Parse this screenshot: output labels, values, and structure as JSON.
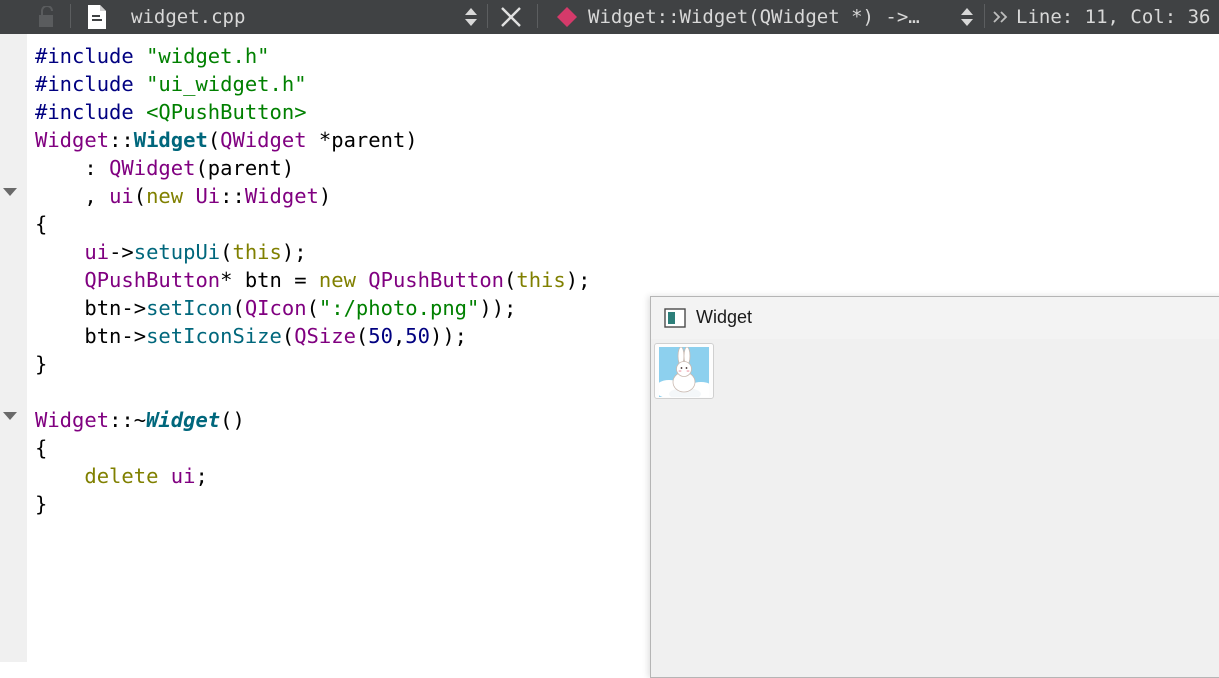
{
  "toolbar": {
    "file_name": "widget.cpp",
    "symbol": "Widget::Widget(QWidget *) ->…",
    "position": "Line: 11, Col: 36"
  },
  "code": {
    "lines": [
      [
        [
          "d",
          "#include "
        ],
        [
          "s",
          "\"widget.h\""
        ]
      ],
      [
        [
          "d",
          "#include "
        ],
        [
          "s",
          "\"ui_widget.h\""
        ]
      ],
      [
        [
          "d",
          "#include "
        ],
        [
          "s",
          "<QPushButton>"
        ]
      ],
      [
        [
          "t",
          "Widget"
        ],
        [
          "",
          "::"
        ],
        [
          "b",
          "Widget"
        ],
        [
          "",
          "("
        ],
        [
          "t",
          "QWidget"
        ],
        [
          "",
          " *parent)"
        ]
      ],
      [
        [
          "",
          "    : "
        ],
        [
          "t",
          "QWidget"
        ],
        [
          "",
          "(parent)"
        ]
      ],
      [
        [
          "",
          "    , "
        ],
        [
          "t",
          "ui"
        ],
        [
          "",
          "("
        ],
        [
          "k",
          "new"
        ],
        [
          "",
          " "
        ],
        [
          "t",
          "Ui"
        ],
        [
          "",
          "::"
        ],
        [
          "t",
          "Widget"
        ],
        [
          "",
          ")"
        ]
      ],
      [
        [
          "",
          "{"
        ]
      ],
      [
        [
          "",
          "    "
        ],
        [
          "t",
          "ui"
        ],
        [
          "",
          "->"
        ],
        [
          "f",
          "setupUi"
        ],
        [
          "",
          "("
        ],
        [
          "k",
          "this"
        ],
        [
          "",
          ");"
        ]
      ],
      [
        [
          "",
          "    "
        ],
        [
          "t",
          "QPushButton"
        ],
        [
          "",
          "* btn = "
        ],
        [
          "k",
          "new"
        ],
        [
          "",
          " "
        ],
        [
          "t",
          "QPushButton"
        ],
        [
          "",
          "("
        ],
        [
          "k",
          "this"
        ],
        [
          "",
          ");"
        ]
      ],
      [
        [
          "",
          "    btn->"
        ],
        [
          "f",
          "setIcon"
        ],
        [
          "",
          "("
        ],
        [
          "t",
          "QIcon"
        ],
        [
          "",
          "("
        ],
        [
          "s",
          "\":/photo.png\""
        ],
        [
          "",
          "));"
        ]
      ],
      [
        [
          "",
          "    btn->"
        ],
        [
          "f",
          "setIconSize"
        ],
        [
          "",
          "("
        ],
        [
          "t",
          "QSize"
        ],
        [
          "",
          "("
        ],
        [
          "n",
          "50"
        ],
        [
          "",
          ","
        ],
        [
          "n",
          "50"
        ],
        [
          "",
          "));"
        ]
      ],
      [
        [
          "",
          "}"
        ]
      ],
      [
        [
          "",
          ""
        ]
      ],
      [
        [
          "t",
          "Widget"
        ],
        [
          "",
          "::~"
        ],
        [
          "bi",
          "Widget"
        ],
        [
          "",
          "()"
        ]
      ],
      [
        [
          "",
          "{"
        ]
      ],
      [
        [
          "",
          "    "
        ],
        [
          "k",
          "delete"
        ],
        [
          "",
          " "
        ],
        [
          "t",
          "ui"
        ],
        [
          "",
          ";"
        ]
      ],
      [
        [
          "",
          "}"
        ]
      ]
    ]
  },
  "window": {
    "title": "Widget"
  },
  "colors": {
    "toolbar_bg": "#404244",
    "keyword": "#808000",
    "type": "#800080",
    "string": "#008000",
    "number": "#000080",
    "function": "#00677c"
  },
  "icons": [
    "lock-icon",
    "file-icon",
    "sort-arrows-icon",
    "close-icon",
    "symbol-diamond-icon",
    "double-chevron-icon",
    "window-app-icon",
    "rabbit-photo-icon"
  ]
}
